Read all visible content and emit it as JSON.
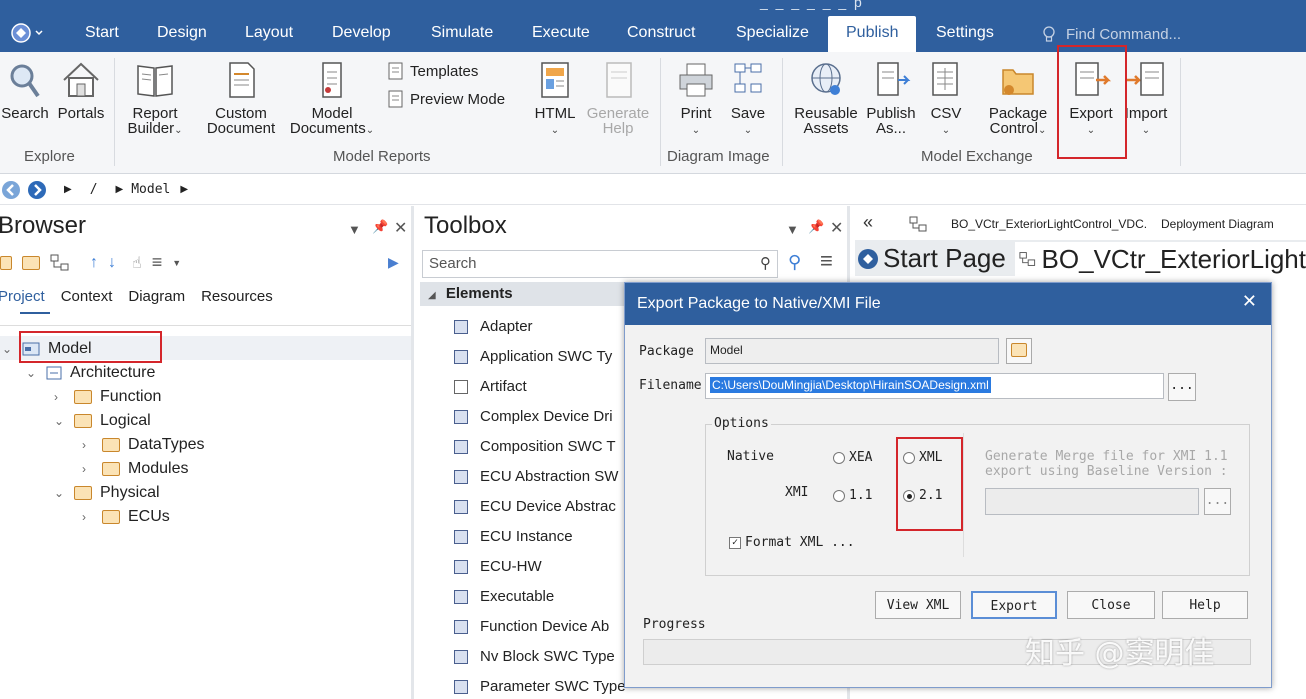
{
  "menu": {
    "title_tail": "_ _ _ _ _ _ p",
    "items": [
      "Start",
      "Design",
      "Layout",
      "Develop",
      "Simulate",
      "Execute",
      "Construct",
      "Specialize",
      "Publish",
      "Settings"
    ],
    "find_placeholder": "Find Command..."
  },
  "ribbon": {
    "explore": {
      "search": "Search",
      "portals": "Portals",
      "group": "Explore"
    },
    "reports": {
      "report_builder_1": "Report",
      "report_builder_2": "Builder",
      "custom_doc_1": "Custom",
      "custom_doc_2": "Document",
      "model_docs_1": "Model",
      "model_docs_2": "Documents",
      "templates": "Templates",
      "preview": "Preview Mode",
      "html": "HTML",
      "gen_help_1": "Generate",
      "gen_help_2": "Help",
      "group": "Model Reports"
    },
    "diagram_image": {
      "print": "Print",
      "save": "Save",
      "group": "Diagram Image"
    },
    "exchange": {
      "reusable_1": "Reusable",
      "reusable_2": "Assets",
      "publish_1": "Publish",
      "publish_2": "As...",
      "csv": "CSV",
      "package_1": "Package",
      "package_2": "Control",
      "export": "Export",
      "import": "Import",
      "group": "Model Exchange"
    }
  },
  "address": {
    "sep": "/",
    "model": "Model"
  },
  "browser": {
    "title": "Browser",
    "tabs": [
      "Project",
      "Context",
      "Diagram",
      "Resources"
    ],
    "tree": {
      "model": "Model",
      "architecture": "Architecture",
      "function": "Function",
      "logical": "Logical",
      "datatypes": "DataTypes",
      "modules": "Modules",
      "physical": "Physical",
      "ecus": "ECUs"
    }
  },
  "toolbox": {
    "title": "Toolbox",
    "search_placeholder": "Search",
    "section": "Elements",
    "items": [
      "Adapter",
      "Application SWC Ty",
      "Artifact",
      "Complex Device Dri",
      "Composition SWC T",
      "ECU Abstraction SW",
      "ECU Device Abstrac",
      "ECU Instance",
      "ECU-HW",
      "Executable",
      "Function Device Ab",
      "Nv Block SWC Type",
      "Parameter SWC Type"
    ]
  },
  "diagram": {
    "header": "BO_VCtr_ExteriorLightControl_VDC.",
    "header_kind": "Deployment Diagram",
    "tab_start": "Start Page",
    "tab_diagram": "BO_VCtr_ExteriorLight"
  },
  "dialog": {
    "title": "Export Package to Native/XMI File",
    "package_label": "Package",
    "package_value": "Model",
    "filename_label": "Filename",
    "filename_value": "C:\\Users\\DouMingjia\\Desktop\\HirainSOADesign.xml",
    "browse": "...",
    "options_label": "Options",
    "native_label": "Native",
    "xmi_label": "XMI",
    "radio_xea": "XEA",
    "radio_xml": "XML",
    "radio_11": "1.1",
    "radio_21": "2.1",
    "format_xml": "Format XML ...",
    "merge_text_1": "Generate Merge file for XMI 1.1",
    "merge_text_2": "export using Baseline Version :",
    "progress_label": "Progress",
    "buttons": {
      "view_xml": "View XML",
      "export": "Export",
      "close": "Close",
      "help": "Help"
    }
  },
  "watermark": "知乎 @窦明佳"
}
